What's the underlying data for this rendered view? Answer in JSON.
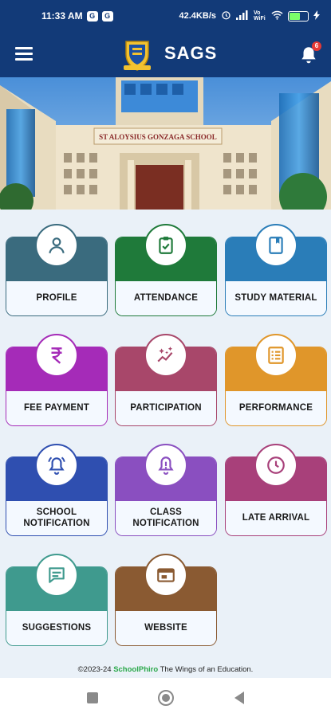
{
  "status_bar": {
    "time": "11:33 AM",
    "notif_badges": [
      "G",
      "G"
    ],
    "net_speed": "42.4KB/s",
    "signal_label": "Vo WiFi",
    "battery_pct": 60
  },
  "app_bar": {
    "title": "SAGS",
    "notification_count": "6"
  },
  "banner": {
    "school_sign": "ST ALOYSIUS GONZAGA SCHOOL"
  },
  "tiles": [
    {
      "label": "PROFILE",
      "icon": "person-icon",
      "color": "#3a6b7e"
    },
    {
      "label": "ATTENDANCE",
      "icon": "clipboard-check-icon",
      "color": "#1f7a3a"
    },
    {
      "label": "STUDY MATERIAL",
      "icon": "book-icon",
      "color": "#2a7db8"
    },
    {
      "label": "FEE PAYMENT",
      "icon": "rupee-icon",
      "color": "#a52bb8"
    },
    {
      "label": "PARTICIPATION",
      "icon": "sparkle-chart-icon",
      "color": "#a8476a"
    },
    {
      "label": "PERFORMANCE",
      "icon": "list-icon",
      "color": "#e0962a"
    },
    {
      "label": "SCHOOL\nNOTIFICATION",
      "icon": "bell-ring-icon",
      "color": "#2f4fb0"
    },
    {
      "label": "CLASS\nNOTIFICATION",
      "icon": "bell-icon",
      "color": "#8a4fc0"
    },
    {
      "label": "LATE ARRIVAL",
      "icon": "clock-icon",
      "color": "#a8407a"
    },
    {
      "label": "SUGGESTIONS",
      "icon": "chat-icon",
      "color": "#3f9a8e"
    },
    {
      "label": "WEBSITE",
      "icon": "browser-icon",
      "color": "#8a5a32"
    }
  ],
  "footer": {
    "prefix": "©2023-24",
    "brand": "SchoolPhiro",
    "suffix": "The Wings of an Education."
  }
}
